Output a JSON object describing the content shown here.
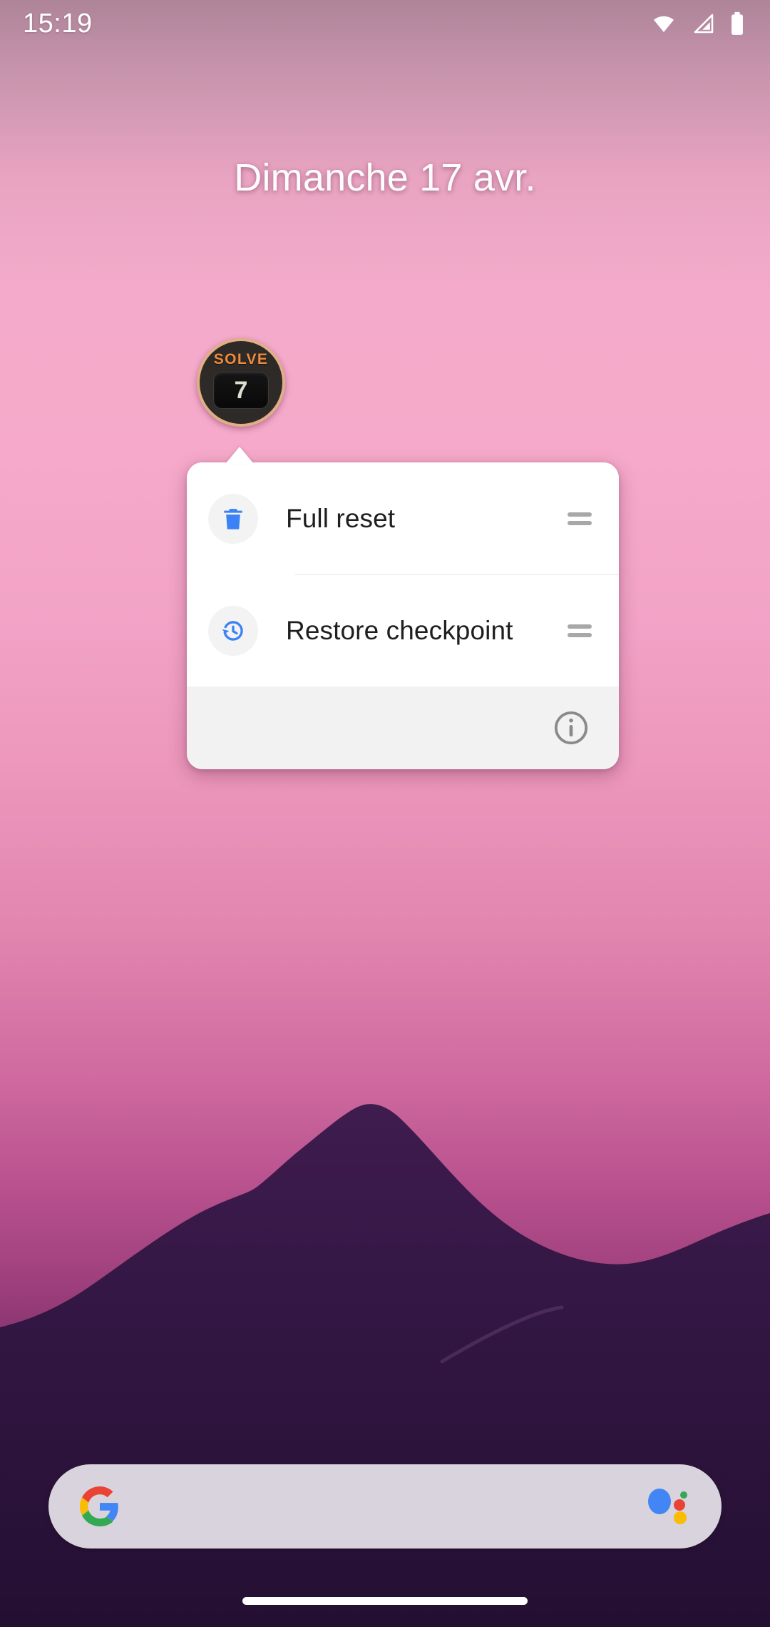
{
  "status_bar": {
    "time": "15:19",
    "icons": [
      {
        "name": "wifi-icon",
        "label": "Wi-Fi full signal"
      },
      {
        "name": "cellular-signal-icon",
        "label": "Mobile signal no SIM"
      },
      {
        "name": "battery-icon",
        "label": "Battery full"
      }
    ]
  },
  "date_widget": {
    "date": "Dimanche 17 avr."
  },
  "app_icon": {
    "brand": "SOLVE",
    "display_value": "7",
    "ring_color": "#e2ae85",
    "brand_color": "#f08a3c",
    "body_color": "#2e2a27"
  },
  "popup": {
    "items": [
      {
        "label": "Full reset",
        "icon": "trash-icon",
        "icon_color": "#3b82f6",
        "handle": "drag-handle-icon"
      },
      {
        "label": "Restore checkpoint",
        "icon": "history-restore-icon",
        "icon_color": "#3b82f6",
        "handle": "drag-handle-icon"
      }
    ],
    "footer": {
      "info_icon": "info-circle-icon",
      "info_color": "#8a8a8a"
    }
  },
  "search_bar": {
    "logo": "google-g-icon",
    "assistant": "google-assistant-icon",
    "query": "",
    "placeholder": "",
    "background": "#d8d3dc"
  },
  "navigation": {
    "gesture_pill": "home-gesture-pill"
  },
  "wallpaper": {
    "description": "mountain-silhouette-sunset",
    "sky_top": "#ae8499",
    "sky_mid": "#f6a9ca",
    "sky_bottom": "#2a0f32",
    "mountain_color": "#3a1a48"
  }
}
